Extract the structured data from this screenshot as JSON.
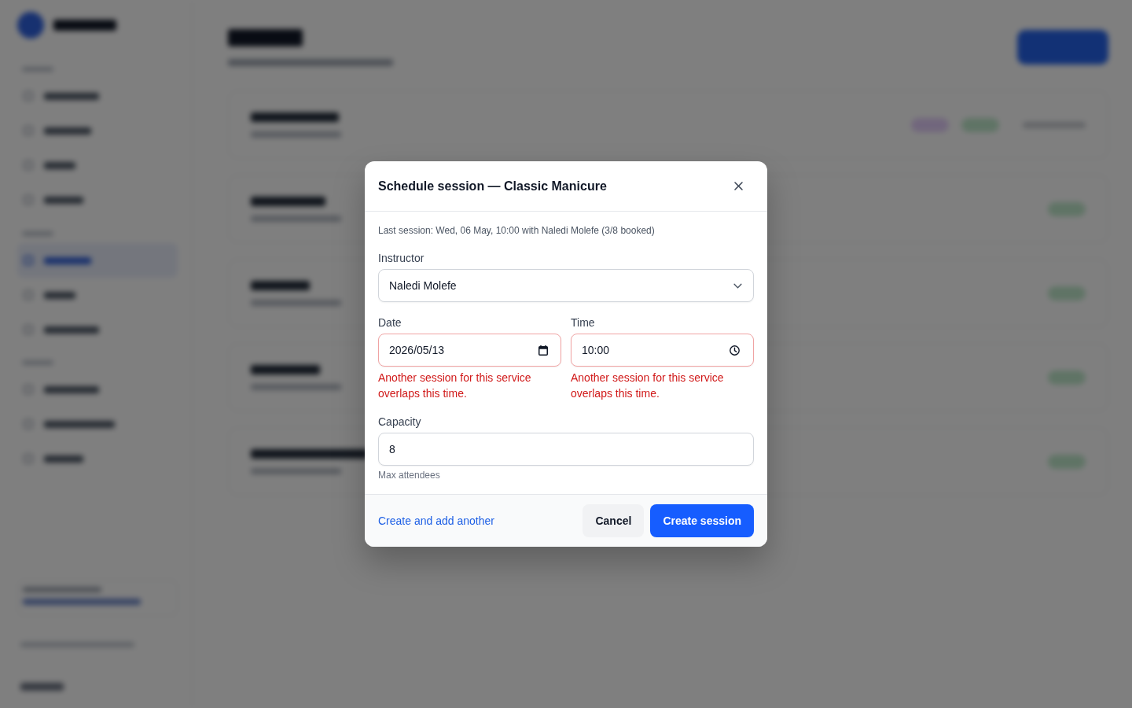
{
  "dialog": {
    "title": "Schedule session — Classic Manicure",
    "info": "Last session: Wed, 06 May, 10:00 with Naledi Molefe (3/8 booked)",
    "fields": [
      {
        "kind": "select",
        "label": "Instructor",
        "value": "Naledi Molefe",
        "invalid": false
      },
      {
        "kind": "date",
        "label": "Date",
        "value": "2026/05/13",
        "invalid": true,
        "error": "Another session for this service overlaps this time."
      },
      {
        "kind": "time",
        "label": "Time",
        "value": "10:00",
        "invalid": true,
        "error": "Another session for this service overlaps this time."
      },
      {
        "kind": "number",
        "label": "Capacity",
        "value": "8",
        "invalid": false,
        "hint": "Max attendees"
      }
    ],
    "footer": {
      "link": "Create and add another",
      "buttons": [
        {
          "kind": "secondary",
          "label": "Cancel"
        },
        {
          "kind": "primary",
          "label": "Create session"
        }
      ]
    }
  }
}
